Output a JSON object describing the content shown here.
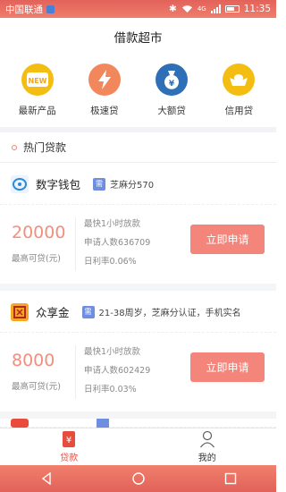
{
  "status_bar": {
    "carrier": "中国联通",
    "network": "4G",
    "time": "11:35"
  },
  "header": {
    "title": "借款超市"
  },
  "categories": [
    {
      "label": "最新产品",
      "icon": "new-badge-icon",
      "color": "#f3bd12",
      "glyph": "NEW"
    },
    {
      "label": "极速贷",
      "icon": "lightning-icon",
      "color": "#f2875c"
    },
    {
      "label": "大额贷",
      "icon": "money-bag-icon",
      "color": "#2e6fb7",
      "glyph": "¥"
    },
    {
      "label": "信用贷",
      "icon": "gold-ingot-icon",
      "color": "#f3bd12"
    }
  ],
  "section": {
    "title": "热门贷款"
  },
  "loans": [
    {
      "name": "数字钱包",
      "tag": "芝麻分570",
      "amount": "20000",
      "amount_label": "最高可贷(元)",
      "info1": "最快1小时放款",
      "info2": "申请人数636709",
      "info3": "日利率0.06%",
      "button": "立即申请"
    },
    {
      "name": "众享金",
      "tag": "21-38周岁，芝麻分认证，手机实名",
      "amount": "8000",
      "amount_label": "最高可贷(元)",
      "info1": "最快1小时放款",
      "info2": "申请人数602429",
      "info3": "日利率0.03%",
      "button": "立即申请"
    }
  ],
  "tabbar": {
    "loans_label": "贷款",
    "mine_label": "我的",
    "active_color": "#e84c3d"
  }
}
